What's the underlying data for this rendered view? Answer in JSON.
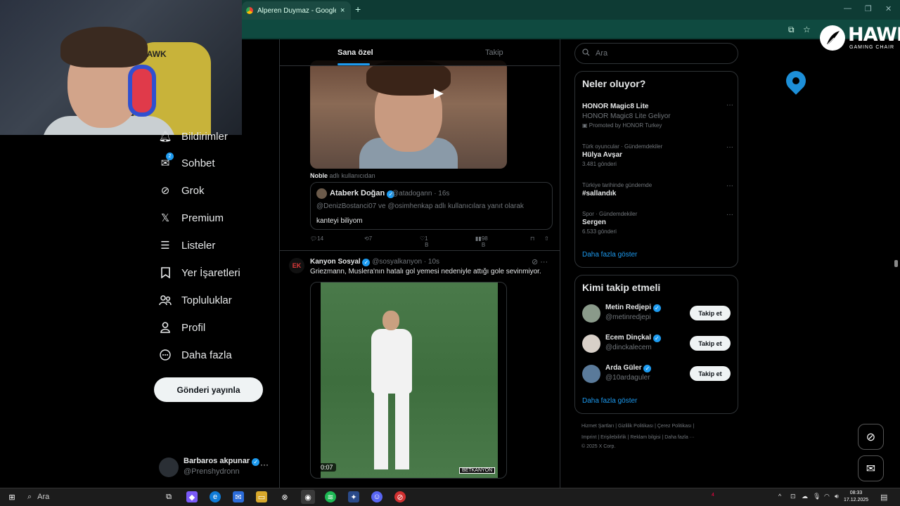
{
  "browser": {
    "tab_title": "Alperen Duymaz - Google'da A",
    "tab_close": "×",
    "new_tab": "+",
    "win_min": "—",
    "win_max": "❐",
    "win_close": "✕"
  },
  "overlay": {
    "hawk_word": "HAWK",
    "hawk_sub": "GAMING CHAIR",
    "chair_text": "HAWK"
  },
  "nav": {
    "items": [
      {
        "label": "Bildirimler",
        "icon": "bell-icon"
      },
      {
        "label": "Sohbet",
        "icon": "mail-icon",
        "badge": "2"
      },
      {
        "label": "Grok",
        "icon": "grok-icon"
      },
      {
        "label": "Premium",
        "icon": "x-logo-icon"
      },
      {
        "label": "Listeler",
        "icon": "list-icon"
      },
      {
        "label": "Yer İşaretleri",
        "icon": "bookmark-icon"
      },
      {
        "label": "Topluluklar",
        "icon": "communities-icon"
      },
      {
        "label": "Profil",
        "icon": "profile-icon"
      },
      {
        "label": "Daha fazla",
        "icon": "more-circle-icon"
      }
    ],
    "post_button": "Gönderi yayınla",
    "account_name": "Barbaros akpunar",
    "account_handle": "@Prenshydronn",
    "account_more": "···"
  },
  "feed": {
    "tab_foryou": "Sana özel",
    "tab_following": "Takip",
    "tweet1": {
      "quote_label_user": "Noble",
      "quote_label_rest": "adlı kullanıcıdan",
      "quote": {
        "name": "Ataberk Doğan",
        "meta": "@atadogann · 16s",
        "reply_to": "@DenizBostanci07 ve @osimhenkap adlı kullanıcılara yanıt olarak",
        "text": "kanteyi biliyom"
      },
      "replies": "14",
      "retweets": "7",
      "likes": "1 B",
      "views": "98 B"
    },
    "tweet2": {
      "avatar_text": "EK",
      "name": "Kanyon Sosyal",
      "meta": "@sosyalkanyon · 10s",
      "text": "Griezmann, Muslera'nın hatalı gol yemesi nedeniyle attığı gole sevinmiyor.",
      "video_time": "0:07",
      "video_brand": "BETKANYON"
    }
  },
  "right": {
    "search_placeholder": "Ara",
    "trends_title": "Neler oluyor?",
    "trends": [
      {
        "context": "",
        "title": "HONOR Magic8 Lite",
        "sub": "HONOR Magic8 Lite Geliyor",
        "count": "Promoted by HONOR Turkey"
      },
      {
        "context": "Türk oyuncular · Gündemdekiler",
        "title": "Hülya Avşar",
        "sub": "",
        "count": "3.481 gönderi"
      },
      {
        "context": "Türkiye tarihinde gündemde",
        "title": "#sallandık",
        "sub": "",
        "count": ""
      },
      {
        "context": "Spor · Gündemdekiler",
        "title": "Sergen",
        "sub": "",
        "count": "6.533 gönderi"
      }
    ],
    "trends_more": "Daha fazla göster",
    "follow_title": "Kimi takip etmeli",
    "follow": [
      {
        "name": "Metin Redjepi",
        "handle": "@metinredjepi",
        "button": "Takip et"
      },
      {
        "name": "Ecem Dinçkal",
        "handle": "@dinckalecem",
        "button": "Takip et"
      },
      {
        "name": "Arda Güler",
        "handle": "@10ardaguler",
        "button": "Takip et"
      }
    ],
    "follow_more": "Daha fazla göster",
    "footer_row1": "Hizmet Şartları  |  Gizlilik Politikası  |  Çerez Politikası  |",
    "footer_row2": "Imprint  |  Erişilebilirlik  |  Reklam bilgisi  |  Daha fazla ···",
    "footer_row3": "© 2025 X Corp."
  },
  "taskbar": {
    "search": "Ara",
    "time": "08:33",
    "date": "17.12.2025",
    "notif_badge": "4"
  },
  "colors": {
    "accent": "#1d9bf0",
    "chrome": "#0e3b34",
    "background": "#000000"
  }
}
